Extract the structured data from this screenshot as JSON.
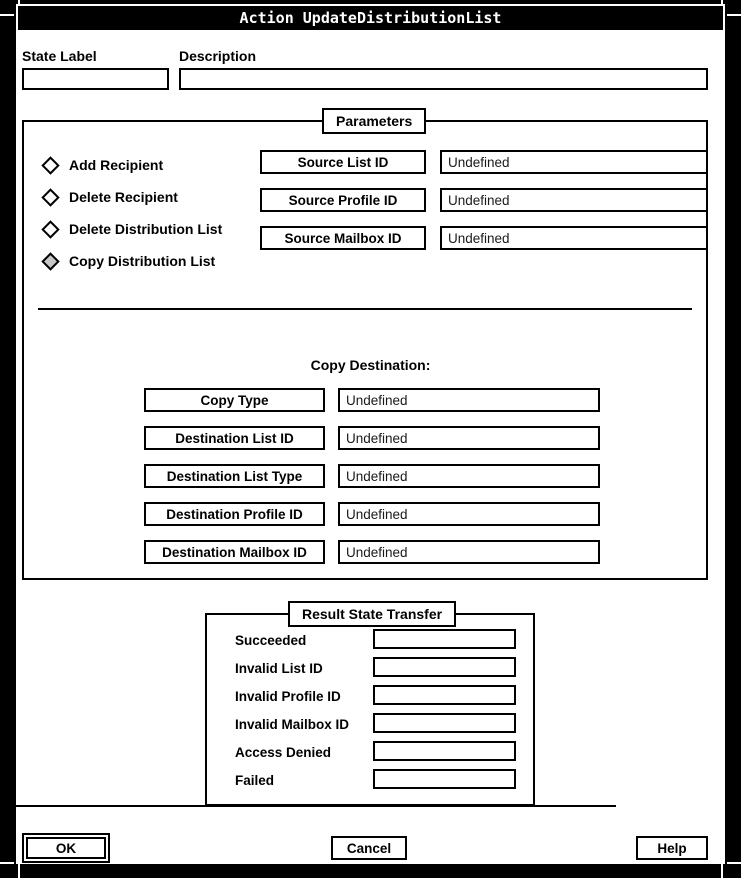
{
  "window": {
    "title": "Action UpdateDistributionList"
  },
  "header": {
    "state_label_caption": "State Label",
    "state_label_value": "",
    "description_caption": "Description",
    "description_value": ""
  },
  "parameters": {
    "group_title": "Parameters",
    "operations": [
      {
        "label": "Add Recipient",
        "selected": false
      },
      {
        "label": "Delete Recipient",
        "selected": false
      },
      {
        "label": "Delete Distribution List",
        "selected": false
      },
      {
        "label": "Copy Distribution List",
        "selected": true
      }
    ],
    "fields": [
      {
        "button": "Source List ID",
        "value": "Undefined"
      },
      {
        "button": "Source Profile ID",
        "value": "Undefined"
      },
      {
        "button": "Source Mailbox ID",
        "value": "Undefined"
      }
    ],
    "copy_destination": {
      "heading": "Copy Destination:",
      "fields": [
        {
          "button": "Copy Type",
          "value": "Undefined"
        },
        {
          "button": "Destination List ID",
          "value": "Undefined"
        },
        {
          "button": "Destination List Type",
          "value": "Undefined"
        },
        {
          "button": "Destination Profile ID",
          "value": "Undefined"
        },
        {
          "button": "Destination Mailbox ID",
          "value": "Undefined"
        }
      ]
    }
  },
  "result_state_transfer": {
    "group_title": "Result State Transfer",
    "rows": [
      {
        "label": "Succeeded",
        "value": ""
      },
      {
        "label": "Invalid List ID",
        "value": ""
      },
      {
        "label": "Invalid Profile ID",
        "value": ""
      },
      {
        "label": "Invalid Mailbox ID",
        "value": ""
      },
      {
        "label": "Access Denied",
        "value": ""
      },
      {
        "label": "Failed",
        "value": ""
      }
    ]
  },
  "actions": {
    "ok": "OK",
    "cancel": "Cancel",
    "help": "Help"
  }
}
